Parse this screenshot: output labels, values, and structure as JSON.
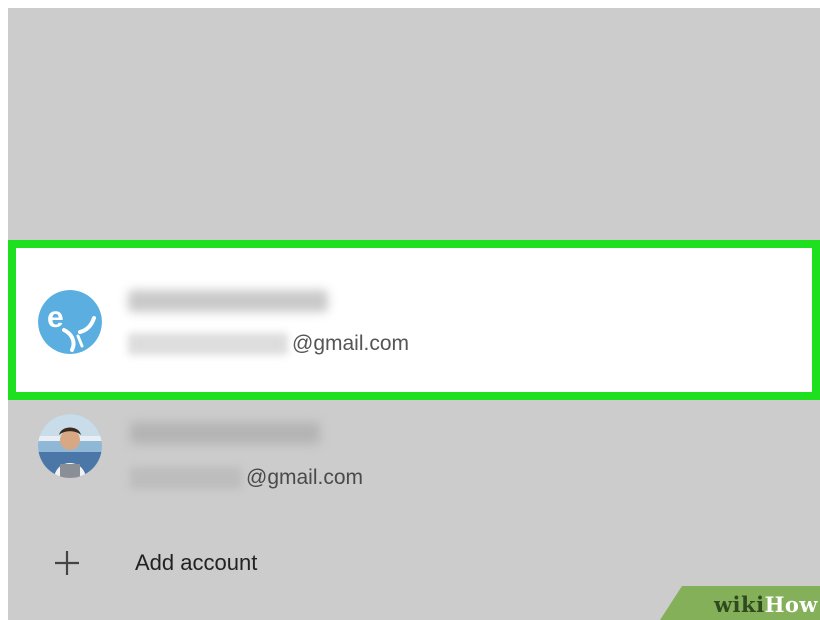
{
  "accounts": [
    {
      "name": "",
      "email_domain": "@gmail.com",
      "selected": true,
      "avatar_icon": "e-logo-icon"
    },
    {
      "name": "",
      "email_domain": "@gmail.com",
      "selected": false,
      "avatar_icon": "user-photo-avatar"
    }
  ],
  "add_account": {
    "icon": "plus-icon",
    "label": "Add account"
  },
  "watermark": {
    "part1": "wiki",
    "part2": "How"
  },
  "colors": {
    "background": "#cccccc",
    "highlight_border": "#1fe01f",
    "selected_row": "#ffffff",
    "logo_avatar": "#5aaee0",
    "watermark_banner": "#85b05a"
  }
}
